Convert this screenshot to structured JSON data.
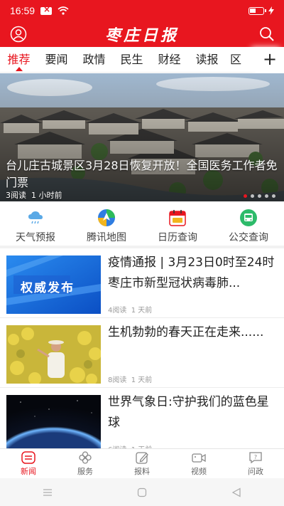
{
  "status_bar": {
    "time": "16:59"
  },
  "header": {
    "logo": "枣庄日报"
  },
  "tabs": [
    {
      "label": "推荐",
      "active": true
    },
    {
      "label": "要闻"
    },
    {
      "label": "政情"
    },
    {
      "label": "民生"
    },
    {
      "label": "财经"
    },
    {
      "label": "读报"
    },
    {
      "label": "区"
    }
  ],
  "tab_plus": "+",
  "banner": {
    "caption": "台儿庄古城景区3月28日恢复开放！全国医务工作者免门票",
    "reads": "3阅读",
    "time": "1 小时前"
  },
  "quick": [
    {
      "label": "天气预报",
      "icon": "weather-icon"
    },
    {
      "label": "腾讯地图",
      "icon": "map-icon"
    },
    {
      "label": "日历查询",
      "icon": "calendar-icon"
    },
    {
      "label": "公交查询",
      "icon": "bus-icon"
    }
  ],
  "news": [
    {
      "title": "疫情通报 | 3月23日0时至24时 枣庄市新型冠状病毒肺...",
      "thumb_text": "权威发布",
      "reads": "4阅读",
      "time": "1 天前"
    },
    {
      "title": "生机勃勃的春天正在走来......",
      "reads": "8阅读",
      "time": "1 天前"
    },
    {
      "title": "世界气象日:守护我们的蓝色星球",
      "reads": "6阅读",
      "time": "1 天前"
    }
  ],
  "bottom_nav": [
    {
      "label": "新闻",
      "active": true
    },
    {
      "label": "服务"
    },
    {
      "label": "报料"
    },
    {
      "label": "视频"
    },
    {
      "label": "问政"
    }
  ],
  "colors": {
    "brand": "#e8161f"
  }
}
